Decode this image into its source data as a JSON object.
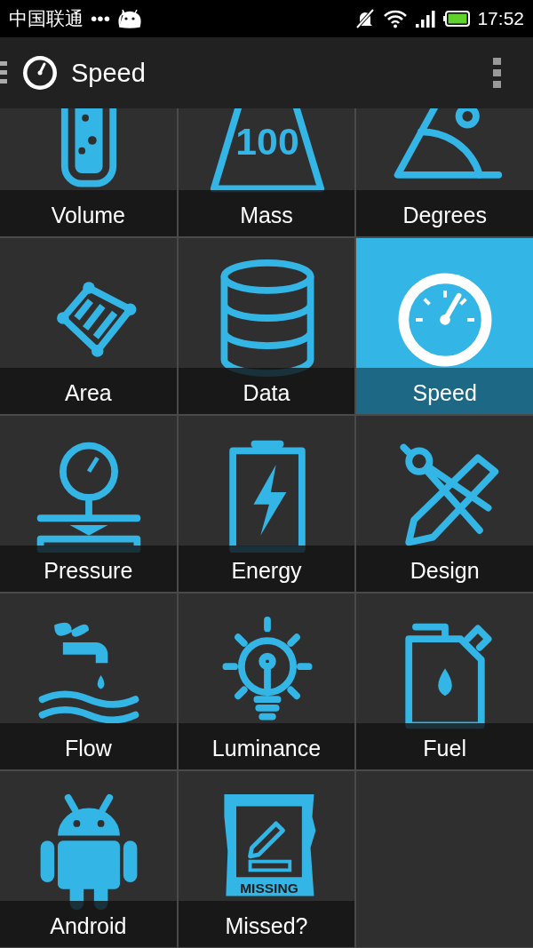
{
  "status_bar": {
    "carrier": "中国联通",
    "dots": "•••",
    "time": "17:52"
  },
  "action_bar": {
    "title": "Speed"
  },
  "tiles": [
    {
      "label": "Volume",
      "selected": false
    },
    {
      "label": "Mass",
      "selected": false,
      "icon_text": "100"
    },
    {
      "label": "Degrees",
      "selected": false
    },
    {
      "label": "Area",
      "selected": false
    },
    {
      "label": "Data",
      "selected": false
    },
    {
      "label": "Speed",
      "selected": true
    },
    {
      "label": "Pressure",
      "selected": false
    },
    {
      "label": "Energy",
      "selected": false
    },
    {
      "label": "Design",
      "selected": false
    },
    {
      "label": "Flow",
      "selected": false
    },
    {
      "label": "Luminance",
      "selected": false
    },
    {
      "label": "Fuel",
      "selected": false
    },
    {
      "label": "Android",
      "selected": false
    },
    {
      "label": "Missed?",
      "selected": false,
      "icon_text": "MISSING"
    }
  ]
}
